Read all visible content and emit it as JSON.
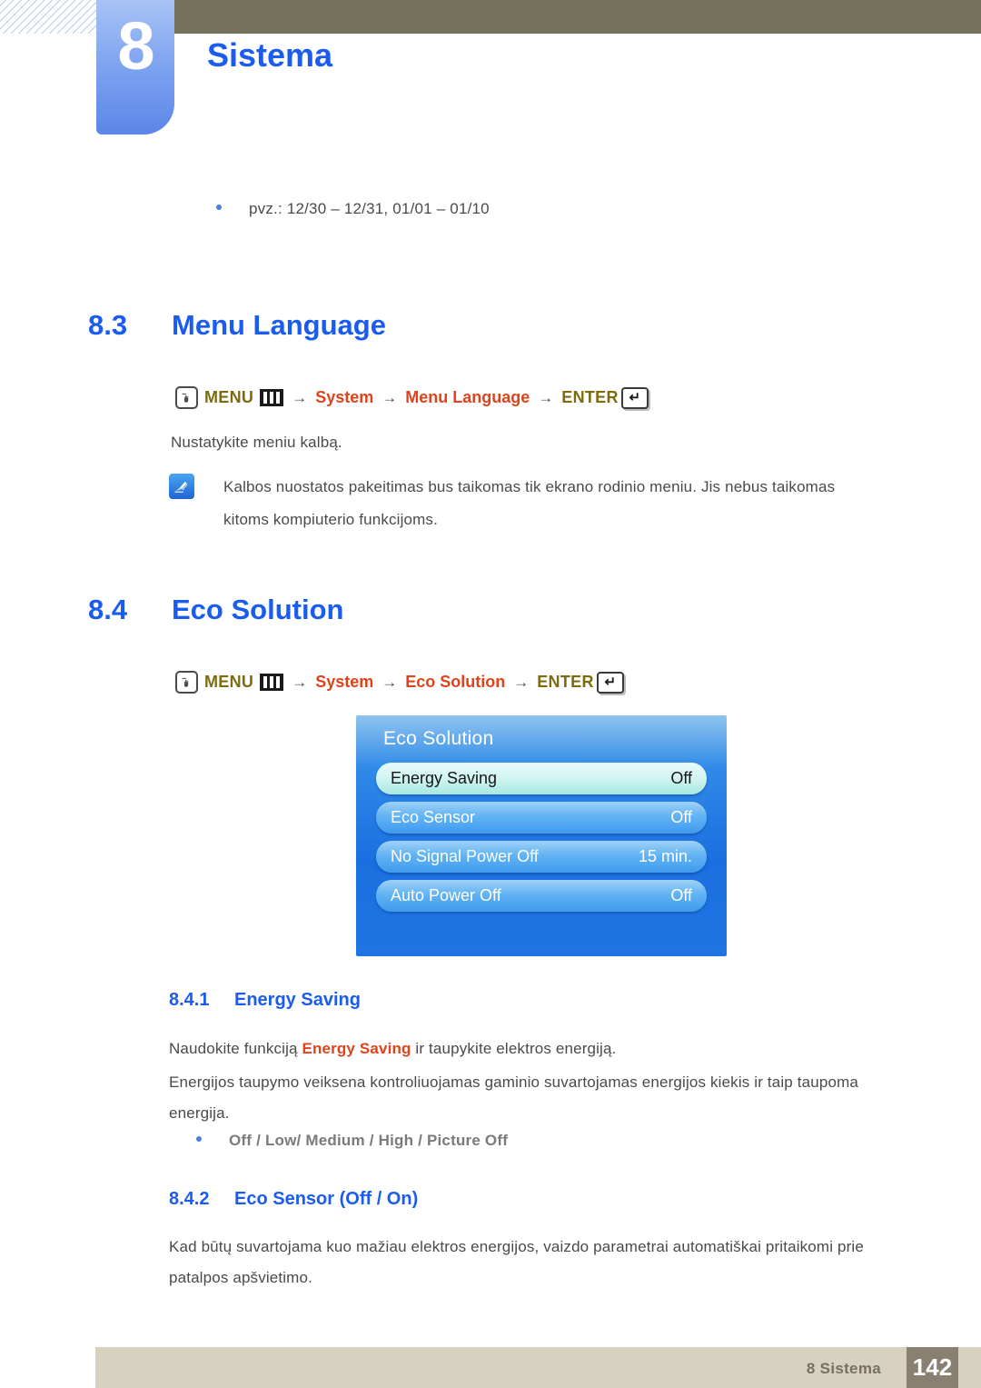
{
  "header": {
    "chapter_number": "8",
    "chapter_title": "Sistema"
  },
  "intro_bullet": {
    "text": "pvz.: 12/30 – 12/31, 01/01 – 01/10"
  },
  "sections": {
    "menu_language": {
      "number": "8.3",
      "title": "Menu Language",
      "navpath": {
        "menu_label": "MENU",
        "arrow": "→",
        "node1": "System",
        "node2": "Menu Language",
        "enter_label": "ENTER",
        "enter_glyph": "↵"
      },
      "paragraph": "Nustatykite meniu kalbą.",
      "note": "Kalbos nuostatos pakeitimas bus taikomas tik ekrano rodinio meniu. Jis nebus taikomas kitoms kompiuterio funkcijoms."
    },
    "eco_solution": {
      "number": "8.4",
      "title": "Eco Solution",
      "navpath": {
        "menu_label": "MENU",
        "arrow": "→",
        "node1": "System",
        "node2": "Eco Solution",
        "enter_label": "ENTER",
        "enter_glyph": "↵"
      },
      "osd": {
        "title": "Eco Solution",
        "rows": [
          {
            "label": "Energy Saving",
            "value": "Off",
            "selected": true
          },
          {
            "label": "Eco Sensor",
            "value": "Off",
            "selected": false
          },
          {
            "label": "No Signal Power Off",
            "value": "15 min.",
            "selected": false
          },
          {
            "label": "Auto Power Off",
            "value": "Off",
            "selected": false
          }
        ]
      }
    },
    "energy_saving": {
      "number": "8.4.1",
      "title": "Energy Saving",
      "para_before": "Naudokite funkciją ",
      "para_emphasis": "Energy Saving",
      "para_after": " ir taupykite elektros energiją.",
      "paragraph2": "Energijos taupymo veiksena kontroliuojamas gaminio suvartojamas energijos kiekis ir taip taupoma energija.",
      "options": [
        {
          "label": "Off",
          "sep": " / "
        },
        {
          "label": "Low",
          "sep": "/ "
        },
        {
          "label": "Medium",
          "sep": " / "
        },
        {
          "label": "High",
          "sep": " / "
        },
        {
          "label": "Picture Off",
          "sep": ""
        }
      ]
    },
    "eco_sensor": {
      "number": "8.4.2",
      "title": "Eco Sensor (Off / On)",
      "paragraph": "Kad būtų suvartojama kuo mažiau elektros energijos, vaizdo parametrai automatiškai pritaikomi prie patalpos apšvietimo."
    }
  },
  "footer": {
    "label": "8 Sistema",
    "page_number": "142"
  },
  "colors": {
    "heading_blue": "#1a5cf0",
    "accent_orange": "#e0431b",
    "key_gold": "#7d6b10",
    "header_bar": "#75715c",
    "footer_bar": "#d7d2bf",
    "footer_page_box": "#8a8071"
  }
}
